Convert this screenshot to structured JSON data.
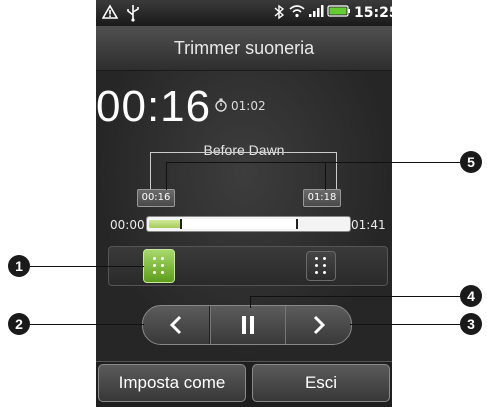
{
  "status_bar": {
    "time": "15:25",
    "icons": [
      "warning-icon",
      "usb-icon",
      "bluetooth-icon",
      "wifi-icon",
      "signal-icon",
      "battery-icon"
    ]
  },
  "screen": {
    "title": "Trimmer suoneria",
    "current_time": "00:16",
    "total_duration": "01:02",
    "song_title": "Before Dawn",
    "marker_start": "00:16",
    "marker_end": "01:18",
    "track_start": "00:00",
    "track_end": "01:41"
  },
  "controls": {
    "prev_icon": "chevron-left-icon",
    "play_pause_icon": "pause-icon",
    "next_icon": "chevron-right-icon"
  },
  "buttons": {
    "set_as": "Imposta come",
    "exit": "Esci"
  },
  "callouts": [
    "1",
    "2",
    "3",
    "4",
    "5"
  ],
  "colors": {
    "accent_green": "#7fbf3a",
    "background": "#2a2a2a",
    "text": "#ffffff"
  }
}
